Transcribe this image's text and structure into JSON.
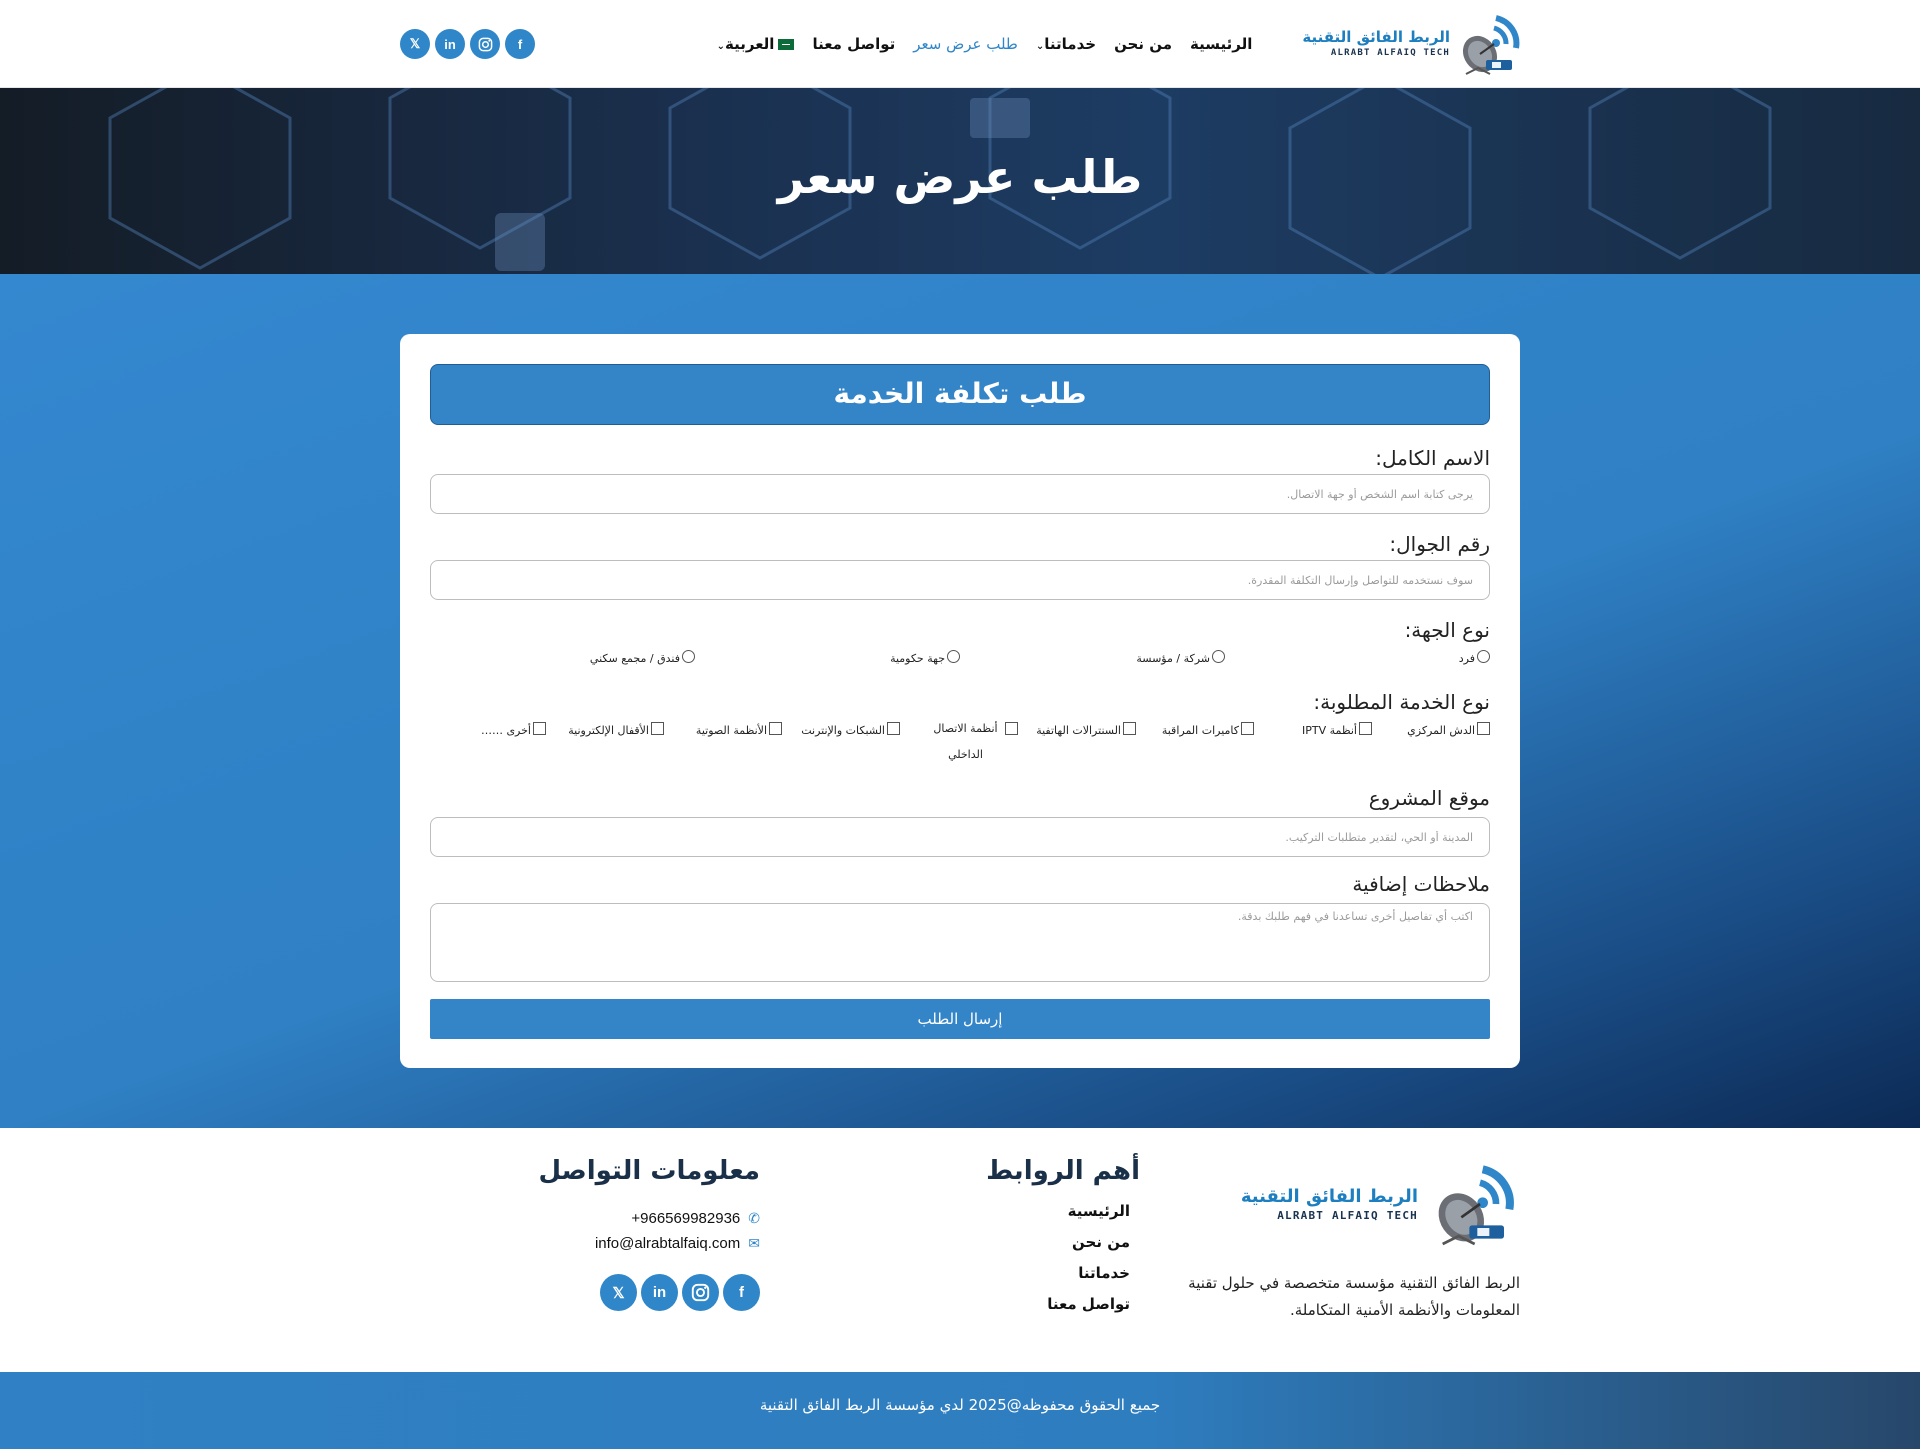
{
  "brand": {
    "name_ar": "الربط الفائق التقنية",
    "name_en": "ALRABT ALFAIQ TECH"
  },
  "nav": {
    "home": "الرئيسية",
    "about": "من نحن",
    "services": "خدماتنا",
    "quote": "طلب عرض سعر",
    "contact": "تواصل معنا",
    "language": "العربية"
  },
  "socials": {
    "x": "X",
    "linkedin": "linkedin",
    "instagram": "instagram",
    "facebook": "facebook"
  },
  "hero": {
    "title": "طلب عرض سعر"
  },
  "form": {
    "header": "طلب تكلفة الخدمة",
    "name_label": "الاسم الكامل:",
    "name_placeholder": "يرجى كتابة اسم الشخص أو جهة الاتصال.",
    "phone_label": "رقم الجوال:",
    "phone_placeholder": "سوف نستخدمه للتواصل وإرسال التكلفة المقدرة.",
    "entity_label": "نوع الجهة:",
    "entity_options": [
      "فرد",
      "شركة / مؤسسة",
      "جهة حكومية",
      "فندق / مجمع سكني"
    ],
    "service_label": "نوع الخدمة المطلوبة:",
    "service_options": [
      "الدش المركزي",
      "أنظمة IPTV",
      "كاميرات المراقبة",
      "السنترالات الهاتفية",
      "أنظمة الاتصال الداخلي",
      "الشبكات والإنترنت",
      "الأنظمة الصوتية",
      "الأقفال الإلكترونية",
      "أخرى ……"
    ],
    "location_label": "موقع المشروع",
    "location_placeholder": "المدينة أو الحي، لتقدير متطلبات التركيب.",
    "notes_label": "ملاحظات إضافية",
    "notes_placeholder": "اكتب أي تفاصيل أخرى تساعدنا في فهم طلبك بدقة.",
    "submit": "إرسال الطلب"
  },
  "footer": {
    "about_text": "الربط الفائق التقنية مؤسسة متخصصة في حلول تقنية المعلومات والأنظمة الأمنية المتكاملة.",
    "links_title": "أهم الروابط",
    "links": [
      "الرئيسية",
      "من نحن",
      "خدماتنا",
      "تواصل معنا"
    ],
    "contact_title": "معلومات التواصل",
    "phone": "+966569982936",
    "email": "info@alrabtalfaiq.com"
  },
  "copyright": "جميع الحقوق محفوظه@2025 لدي مؤسسة الربط الفائق التقنية",
  "colors": {
    "primary": "#3385c8",
    "dark_navy": "#0c2a55",
    "text": "#111111"
  }
}
